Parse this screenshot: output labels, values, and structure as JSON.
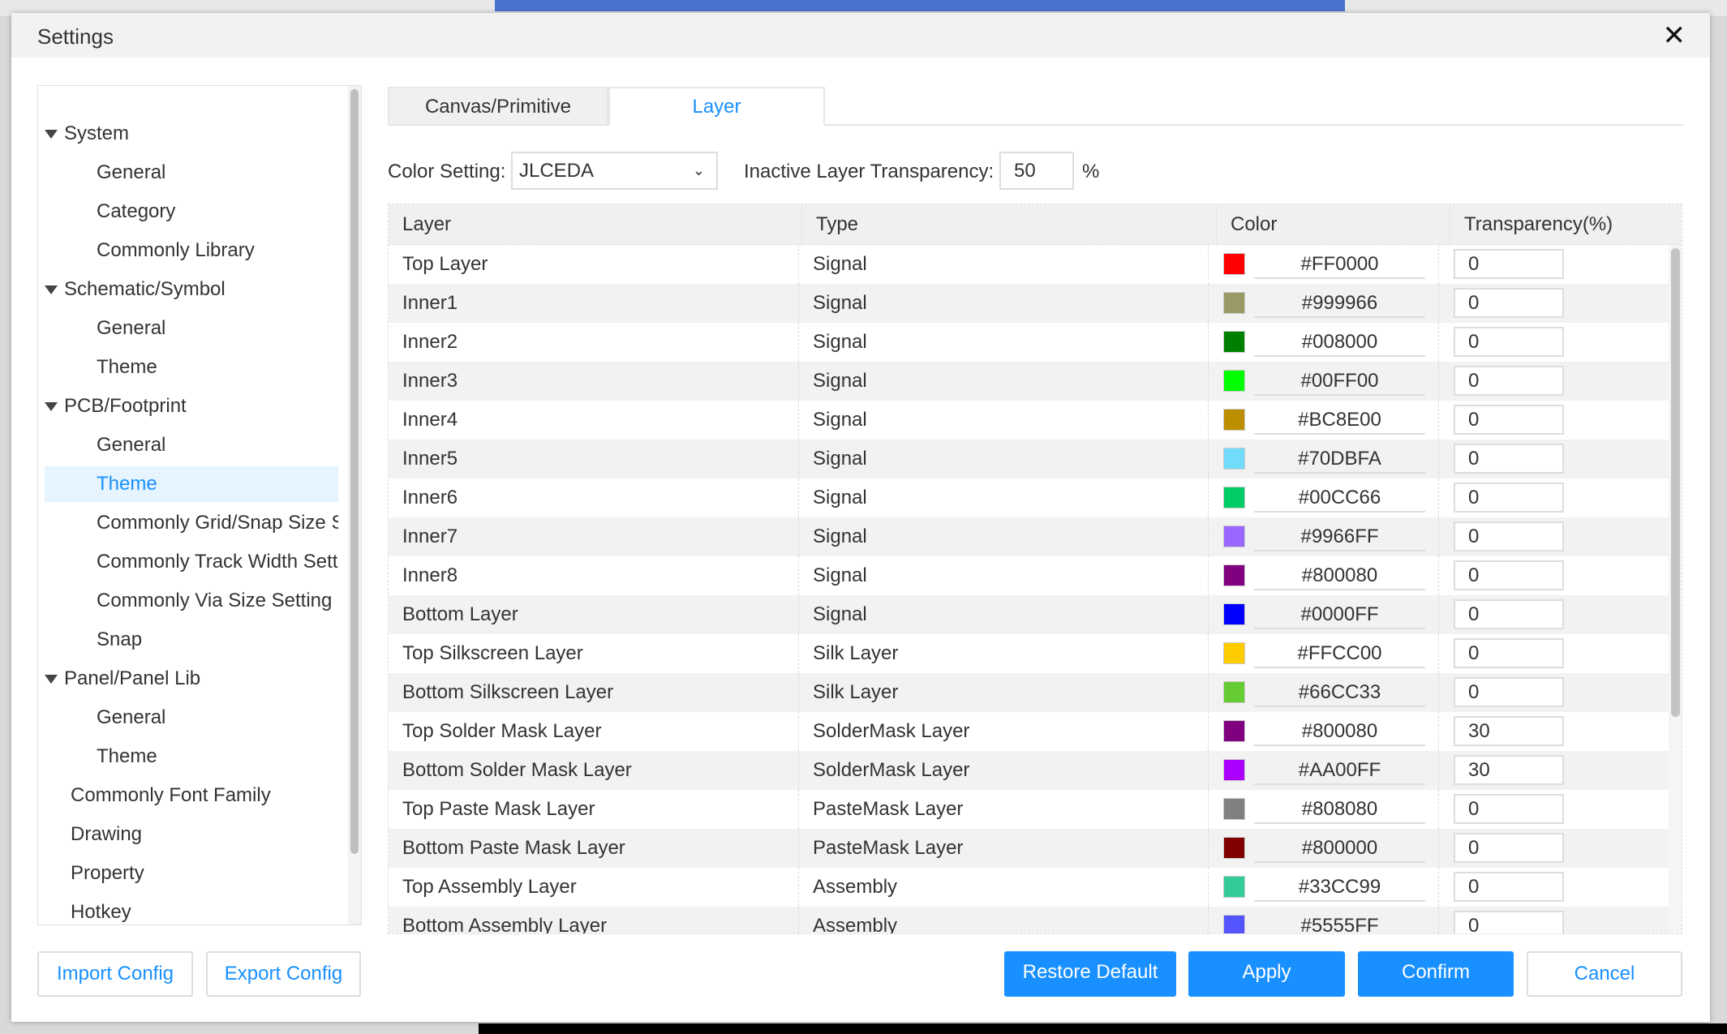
{
  "window": {
    "title": "Settings",
    "close_icon": "close-icon"
  },
  "tree": [
    {
      "label": "System",
      "level": 0,
      "expanded": true
    },
    {
      "label": "General",
      "level": 1
    },
    {
      "label": "Category",
      "level": 1
    },
    {
      "label": "Commonly Library",
      "level": 1
    },
    {
      "label": "Schematic/Symbol",
      "level": 0,
      "expanded": true
    },
    {
      "label": "General",
      "level": 1
    },
    {
      "label": "Theme",
      "level": 1
    },
    {
      "label": "PCB/Footprint",
      "level": 0,
      "expanded": true
    },
    {
      "label": "General",
      "level": 1
    },
    {
      "label": "Theme",
      "level": 1,
      "selected": true
    },
    {
      "label": "Commonly Grid/Snap Size Setting",
      "level": 1
    },
    {
      "label": "Commonly Track Width Setting",
      "level": 1
    },
    {
      "label": "Commonly Via Size Setting",
      "level": 1
    },
    {
      "label": "Snap",
      "level": 1
    },
    {
      "label": "Panel/Panel Lib",
      "level": 0,
      "expanded": true
    },
    {
      "label": "General",
      "level": 1
    },
    {
      "label": "Theme",
      "level": 1
    },
    {
      "label": "Commonly Font Family",
      "level": 2
    },
    {
      "label": "Drawing",
      "level": 2
    },
    {
      "label": "Property",
      "level": 2
    },
    {
      "label": "Hotkey",
      "level": 2
    }
  ],
  "tabs": [
    {
      "label": "Canvas/Primitive",
      "active": false
    },
    {
      "label": "Layer",
      "active": true
    }
  ],
  "options": {
    "color_setting_label": "Color Setting:",
    "color_setting_value": "JLCEDA",
    "inactive_label": "Inactive Layer Transparency:",
    "inactive_value": "50",
    "percent": "%"
  },
  "table": {
    "headers": [
      "Layer",
      "Type",
      "Color",
      "Transparency(%)"
    ],
    "rows": [
      {
        "layer": "Top Layer",
        "type": "Signal",
        "color": "#FF0000",
        "transparency": "0"
      },
      {
        "layer": "Inner1",
        "type": "Signal",
        "color": "#999966",
        "transparency": "0"
      },
      {
        "layer": "Inner2",
        "type": "Signal",
        "color": "#008000",
        "transparency": "0"
      },
      {
        "layer": "Inner3",
        "type": "Signal",
        "color": "#00FF00",
        "transparency": "0"
      },
      {
        "layer": "Inner4",
        "type": "Signal",
        "color": "#BC8E00",
        "transparency": "0"
      },
      {
        "layer": "Inner5",
        "type": "Signal",
        "color": "#70DBFA",
        "transparency": "0"
      },
      {
        "layer": "Inner6",
        "type": "Signal",
        "color": "#00CC66",
        "transparency": "0"
      },
      {
        "layer": "Inner7",
        "type": "Signal",
        "color": "#9966FF",
        "transparency": "0"
      },
      {
        "layer": "Inner8",
        "type": "Signal",
        "color": "#800080",
        "transparency": "0"
      },
      {
        "layer": "Bottom Layer",
        "type": "Signal",
        "color": "#0000FF",
        "transparency": "0"
      },
      {
        "layer": "Top Silkscreen Layer",
        "type": "Silk Layer",
        "color": "#FFCC00",
        "transparency": "0"
      },
      {
        "layer": "Bottom Silkscreen Layer",
        "type": "Silk Layer",
        "color": "#66CC33",
        "transparency": "0"
      },
      {
        "layer": "Top Solder Mask Layer",
        "type": "SolderMask Layer",
        "color": "#800080",
        "transparency": "30"
      },
      {
        "layer": "Bottom Solder Mask Layer",
        "type": "SolderMask Layer",
        "color": "#AA00FF",
        "transparency": "30"
      },
      {
        "layer": "Top Paste Mask Layer",
        "type": "PasteMask Layer",
        "color": "#808080",
        "transparency": "0"
      },
      {
        "layer": "Bottom Paste Mask Layer",
        "type": "PasteMask Layer",
        "color": "#800000",
        "transparency": "0"
      },
      {
        "layer": "Top Assembly Layer",
        "type": "Assembly",
        "color": "#33CC99",
        "transparency": "0"
      },
      {
        "layer": "Bottom Assembly Layer",
        "type": "Assembly",
        "color": "#5555FF",
        "transparency": "0"
      }
    ]
  },
  "footer": {
    "import": "Import Config",
    "export": "Export Config",
    "restore": "Restore Default",
    "apply": "Apply",
    "confirm": "Confirm",
    "cancel": "Cancel"
  },
  "colors": {
    "accent": "#1890FF",
    "selected_bg": "#E6F4FF"
  }
}
